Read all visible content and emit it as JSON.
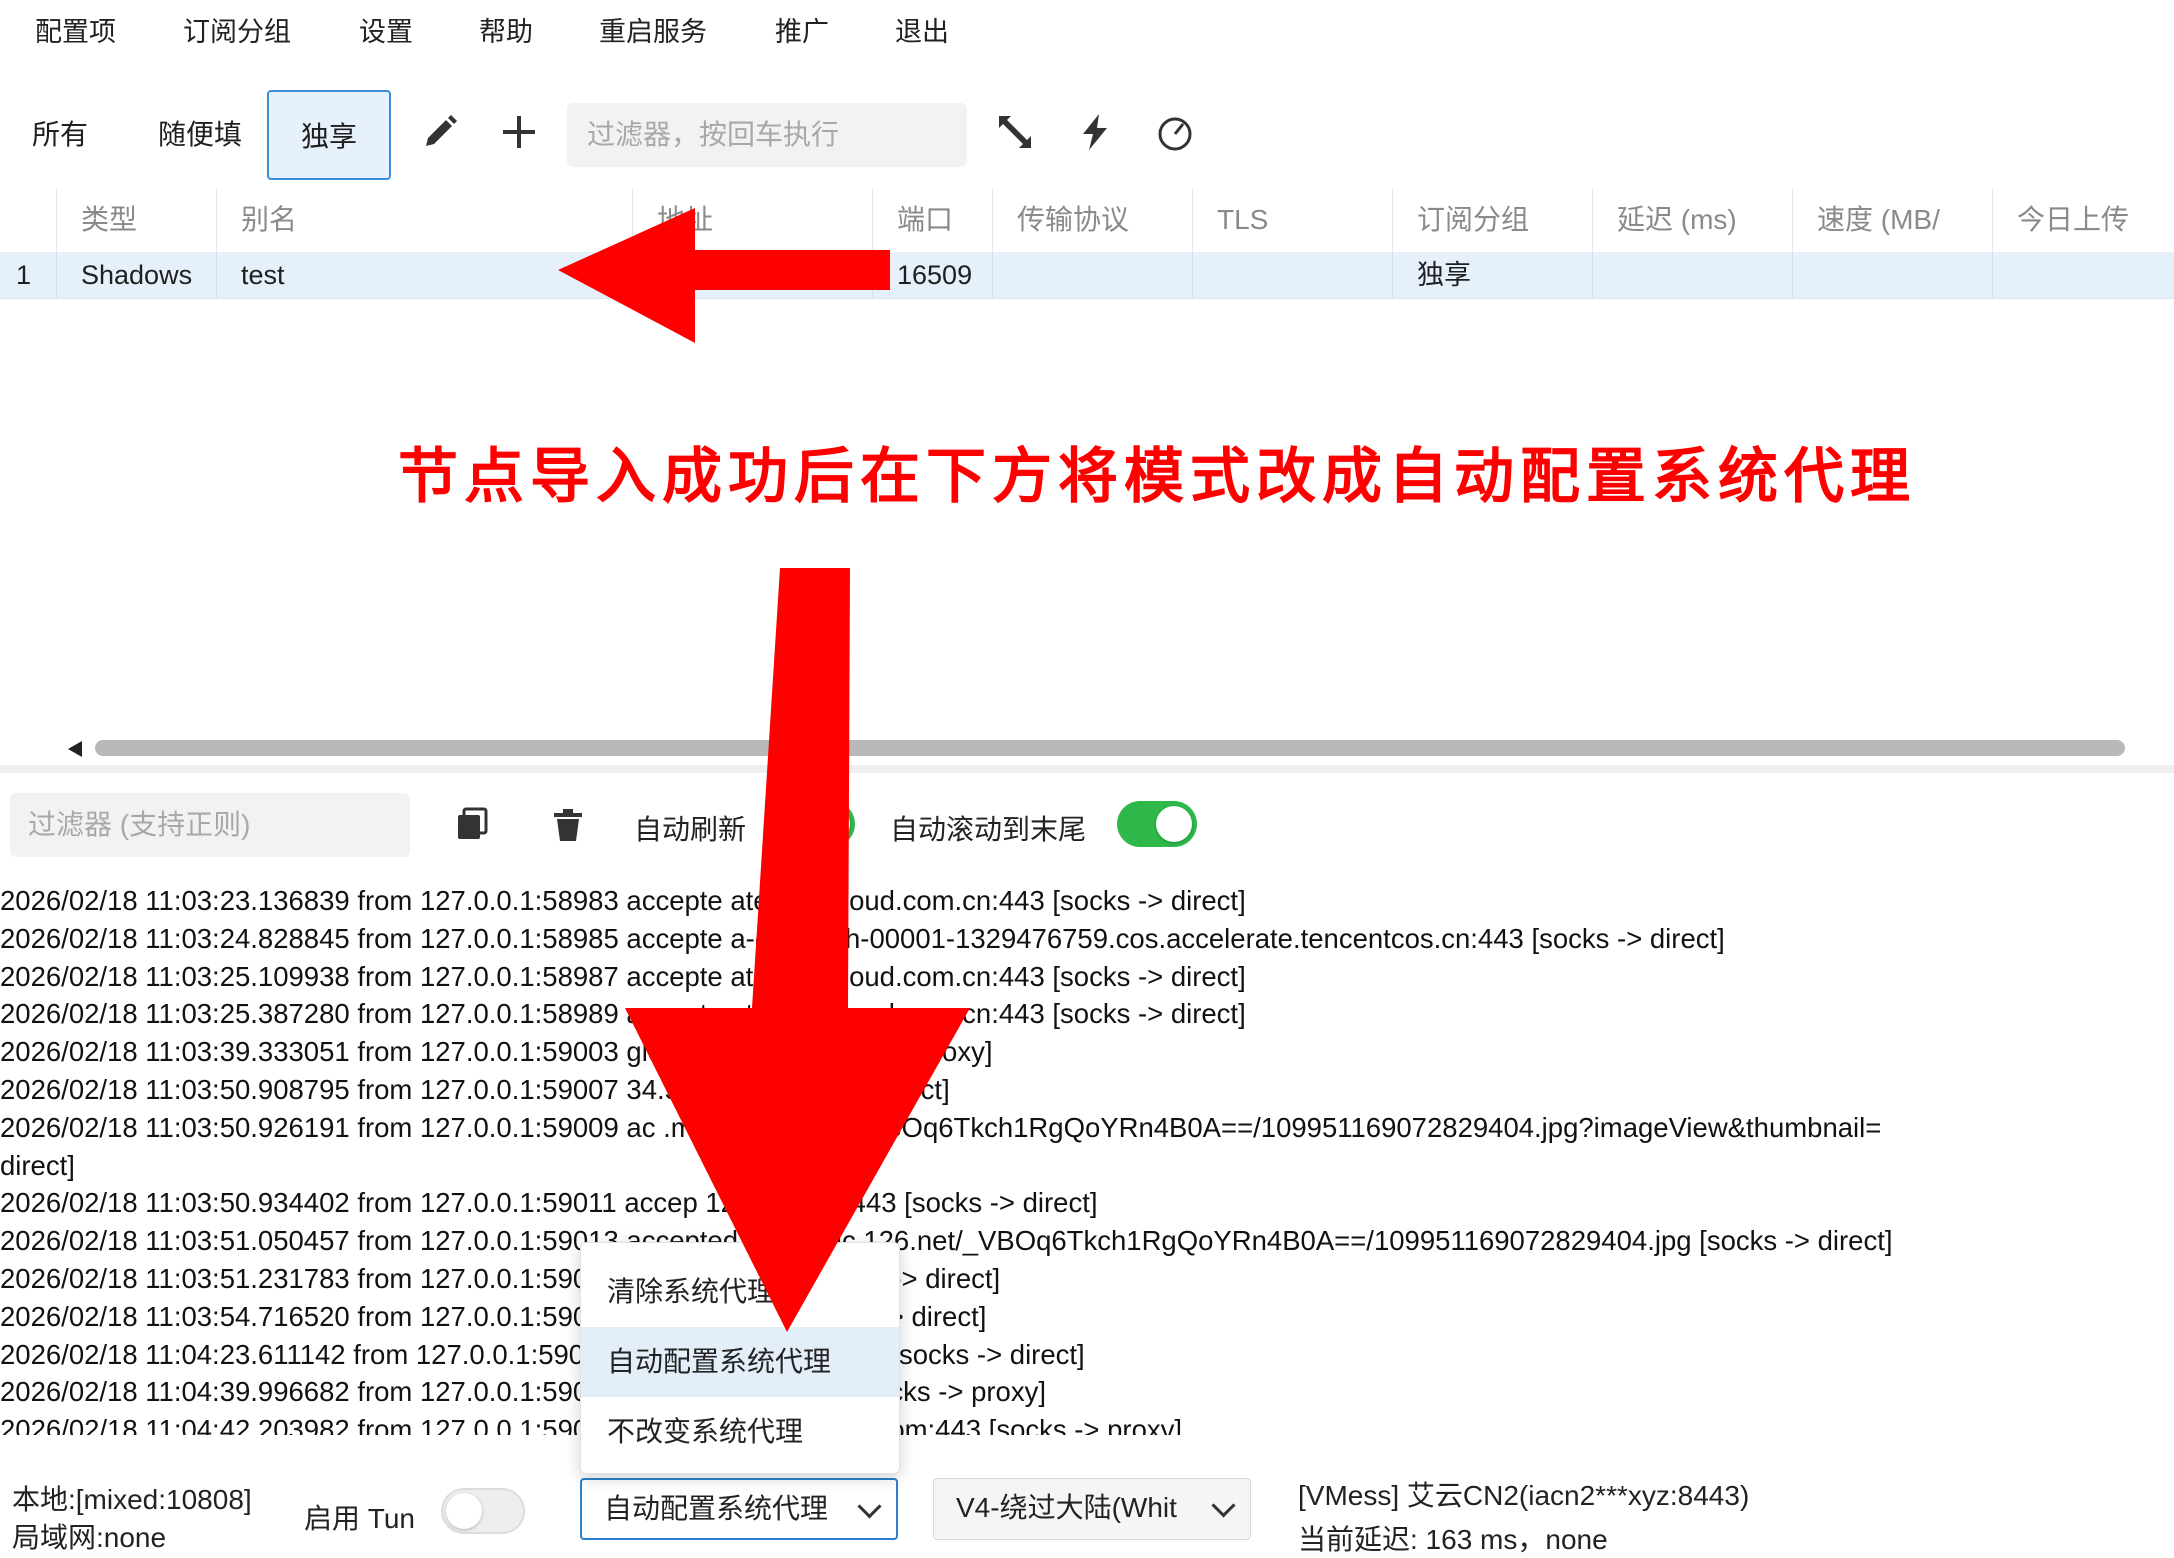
{
  "menu": [
    "配置项",
    "订阅分组",
    "设置",
    "帮助",
    "重启服务",
    "推广",
    "退出"
  ],
  "tabs": [
    {
      "label": "所有",
      "active": false
    },
    {
      "label": "随便填",
      "active": false
    },
    {
      "label": "独享",
      "active": true
    }
  ],
  "toolbar": {
    "filter_placeholder": "过滤器，按回车执行",
    "icons": [
      "edit-icon",
      "plus-icon",
      "expand-icon",
      "lightning-icon",
      "speedometer-icon"
    ]
  },
  "table": {
    "columns": [
      "类型",
      "别名",
      "地址",
      "端口",
      "传输协议",
      "TLS",
      "订阅分组",
      "延迟 (ms)",
      "速度 (MB/",
      "今日上传"
    ],
    "rows": [
      {
        "index": "1",
        "type": "Shadows",
        "alias": "test",
        "address": "",
        "port": "16509",
        "transport": "",
        "tls": "",
        "group": "独享",
        "delay": "",
        "speed": "",
        "upload": ""
      }
    ]
  },
  "annotation": "节点导入成功后在下方将模式改成自动配置系统代理",
  "log_toolbar": {
    "filter_placeholder": "过滤器 (支持正则)",
    "auto_refresh_label": "自动刷新",
    "auto_refresh_on": true,
    "auto_scroll_label": "自动滚动到末尾",
    "auto_scroll_on": true
  },
  "log_lines": [
    "2026/02/18 11:03:23.136839 from 127.0.0.1:58983 accepte          ateway.icloud.com.cn:443 [socks -> direct]",
    "2026/02/18 11:03:24.828845 from 127.0.0.1:58985 accepte          a-cn-south-00001-1329476759.cos.accelerate.tencentcos.cn:443 [socks -> direct]",
    "2026/02/18 11:03:25.109938 from 127.0.0.1:58987 accepte          ateway.icloud.com.cn:443 [socks -> direct]",
    "2026/02/18 11:03:25.387280 from 127.0.0.1:58989 accepte          ateway.icloud.com.cn:443 [socks -> direct]",
    "2026/02/18 11:03:39.333051 from 127.0.0.1:59003                       gle.com:5228 [socks -> proxy]",
    "2026/02/18 11:03:50.908795 from 127.0.0.1:59007                       34.58:443 [socks -> direct]",
    "2026/02/18 11:03:50.926191 from 127.0.0.1:59009 ac               .music.126.net/_VBOq6Tkch1RgQoYRn4B0A==/109951169072829404.jpg?imageView&thumbnail=",
    "direct]",
    "2026/02/18 11:03:50.934402 from 127.0.0.1:59011 accep             124.200.67:443 [socks -> direct]",
    "2026/02/18 11:03:51.050457 from 127.0.0.1:59013 accepted          p4.music.126.net/_VBOq6Tkch1RgQoYRn4B0A==/109951169072829404.jpg [socks -> direct]",
    "2026/02/18 11:03:51.231783 from 127.0.0.1:59015                       ic.126.net:443 [socks -> direct]",
    "2026/02/18 11:03:54.716520 from 127.0.0.1:59017                       163.com:443 [socks -> direct]",
    "2026/02/18 11:04:23.611142 from 127.0.0.1:59019                       n.music.163.com:443 [socks -> direct]",
    "2026/02/18 11:04:39.996682 from 127.0.0.1:59021                       .google.com:5228 [socks -> proxy]",
    "2026/02/18 11:04:42.203982 from 127.0.0.1:59023                       services.googleapis.com:443 [socks -> proxy]"
  ],
  "dropdown": {
    "options": [
      "清除系统代理",
      "自动配置系统代理",
      "不改变系统代理"
    ],
    "highlighted_index": 1
  },
  "status": {
    "local": "本地:[mixed:10808]",
    "lan": "局域网:none",
    "tun_label": "启用 Tun",
    "tun_on": false,
    "proxy_mode": "自动配置系统代理",
    "routing": "V4-绕过大陆(Whit",
    "server": "[VMess] 艾云CN2(iacn2***xyz:8443)",
    "latency": "当前延迟: 163 ms，none"
  },
  "colors": {
    "accent": "#2c7fd0",
    "annotation": "#ff0000",
    "toggle_on": "#2fb84a",
    "row_selected": "#e6f0fb"
  }
}
